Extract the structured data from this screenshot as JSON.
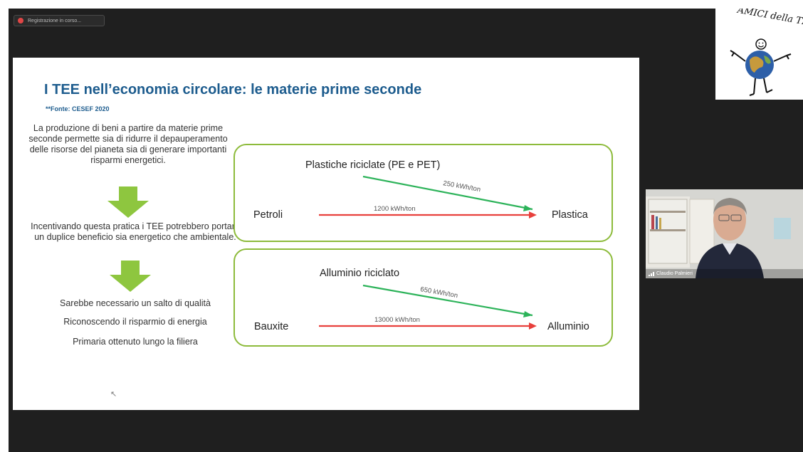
{
  "recording": {
    "label": "Registrazione in corso..."
  },
  "slide": {
    "title": "I TEE nell’economia circolare: le materie prime seconde",
    "source": "**Fonte: CESEF 2020",
    "paragraphs": [
      "La produzione di beni a partire da materie prime seconde permette sia di ridurre il depauperamento delle risorse del pianeta sia di generare importanti risparmi energetici.",
      "Incentivando questa pratica i TEE potrebbero portare un duplice beneficio sia energetico che ambientale.",
      "Sarebbe necessario un salto di qualità",
      "Riconoscendo il risparmio di energia",
      "Primaria ottenuto lungo la filiera"
    ],
    "diagram1": {
      "recycled": "Plastiche riciclate (PE e PET)",
      "recycled_rate": "250 kWh/ton",
      "source": "Petroli",
      "source_rate": "1200 kWh/ton",
      "product": "Plastica"
    },
    "diagram2": {
      "recycled": "Alluminio riciclato",
      "recycled_rate": "650 kWh/ton",
      "source": "Bauxite",
      "source_rate": "13000 kWh/ton",
      "product": "Alluminio"
    }
  },
  "logo": {
    "text": "AMICI della TERRA"
  },
  "participant": {
    "name": "Claudio Palmieri"
  },
  "colors": {
    "title": "#1d5c8e",
    "box_border": "#8dbb3b",
    "arrow_green": "#2db35a",
    "arrow_red": "#e8403c",
    "down_arrow": "#8ec63f"
  }
}
